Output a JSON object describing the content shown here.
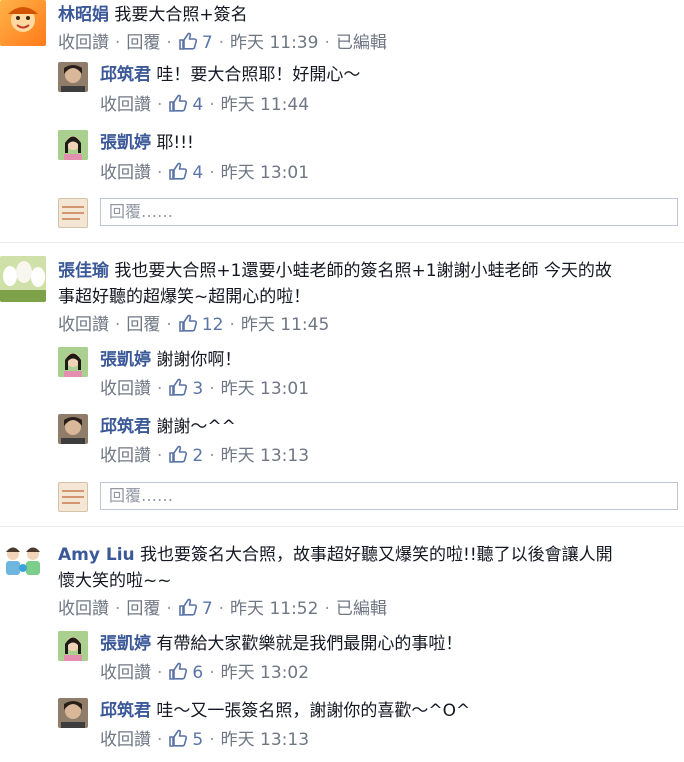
{
  "labels": {
    "unlike": "收回讚",
    "reply": "回覆",
    "edited": "已編輯",
    "reply_placeholder": "回覆……"
  },
  "icons": {
    "like": "thumbs-up-icon"
  },
  "colors": {
    "author": "#3b5998",
    "meta": "#6f7784",
    "like_count": "#5b74a8"
  },
  "threads": [
    {
      "author": "林昭娟",
      "text": "我要大合照+簽名",
      "likes": "7",
      "time": "昨天 11:39",
      "replies": [
        {
          "author": "邱筑君",
          "text": "哇！要大合照耶！好開心～",
          "likes": "4",
          "time": "昨天 11:44"
        },
        {
          "author": "張凱婷",
          "text": "耶!!!",
          "likes": "4",
          "time": "昨天 13:01"
        }
      ]
    },
    {
      "author": "張佳瑜",
      "text_line1": "我也要大合照+1還要小蛙老師的簽名照+1謝謝小蛙老師 今天的故",
      "text_line2": "事超好聽的超爆笑~超開心的啦！",
      "likes": "12",
      "time": "昨天 11:45",
      "replies": [
        {
          "author": "張凱婷",
          "text": "謝謝你啊！",
          "likes": "3",
          "time": "昨天 13:01"
        },
        {
          "author": "邱筑君",
          "text": "謝謝～^^",
          "likes": "2",
          "time": "昨天 13:13"
        }
      ]
    },
    {
      "author": "Amy Liu",
      "text_line1": "我也要簽名大合照，故事超好聽又爆笑的啦!!聽了以後會讓人開",
      "text_line2": "懷大笑的啦~~",
      "likes": "7",
      "time": "昨天 11:52",
      "replies": [
        {
          "author": "張凱婷",
          "text": "有帶給大家歡樂就是我們最開心的事啦！",
          "likes": "6",
          "time": "昨天 13:02"
        },
        {
          "author": "邱筑君",
          "text": "哇～又一張簽名照，謝謝你的喜歡～^O^",
          "likes": "5",
          "time": "昨天 13:13"
        }
      ]
    }
  ]
}
